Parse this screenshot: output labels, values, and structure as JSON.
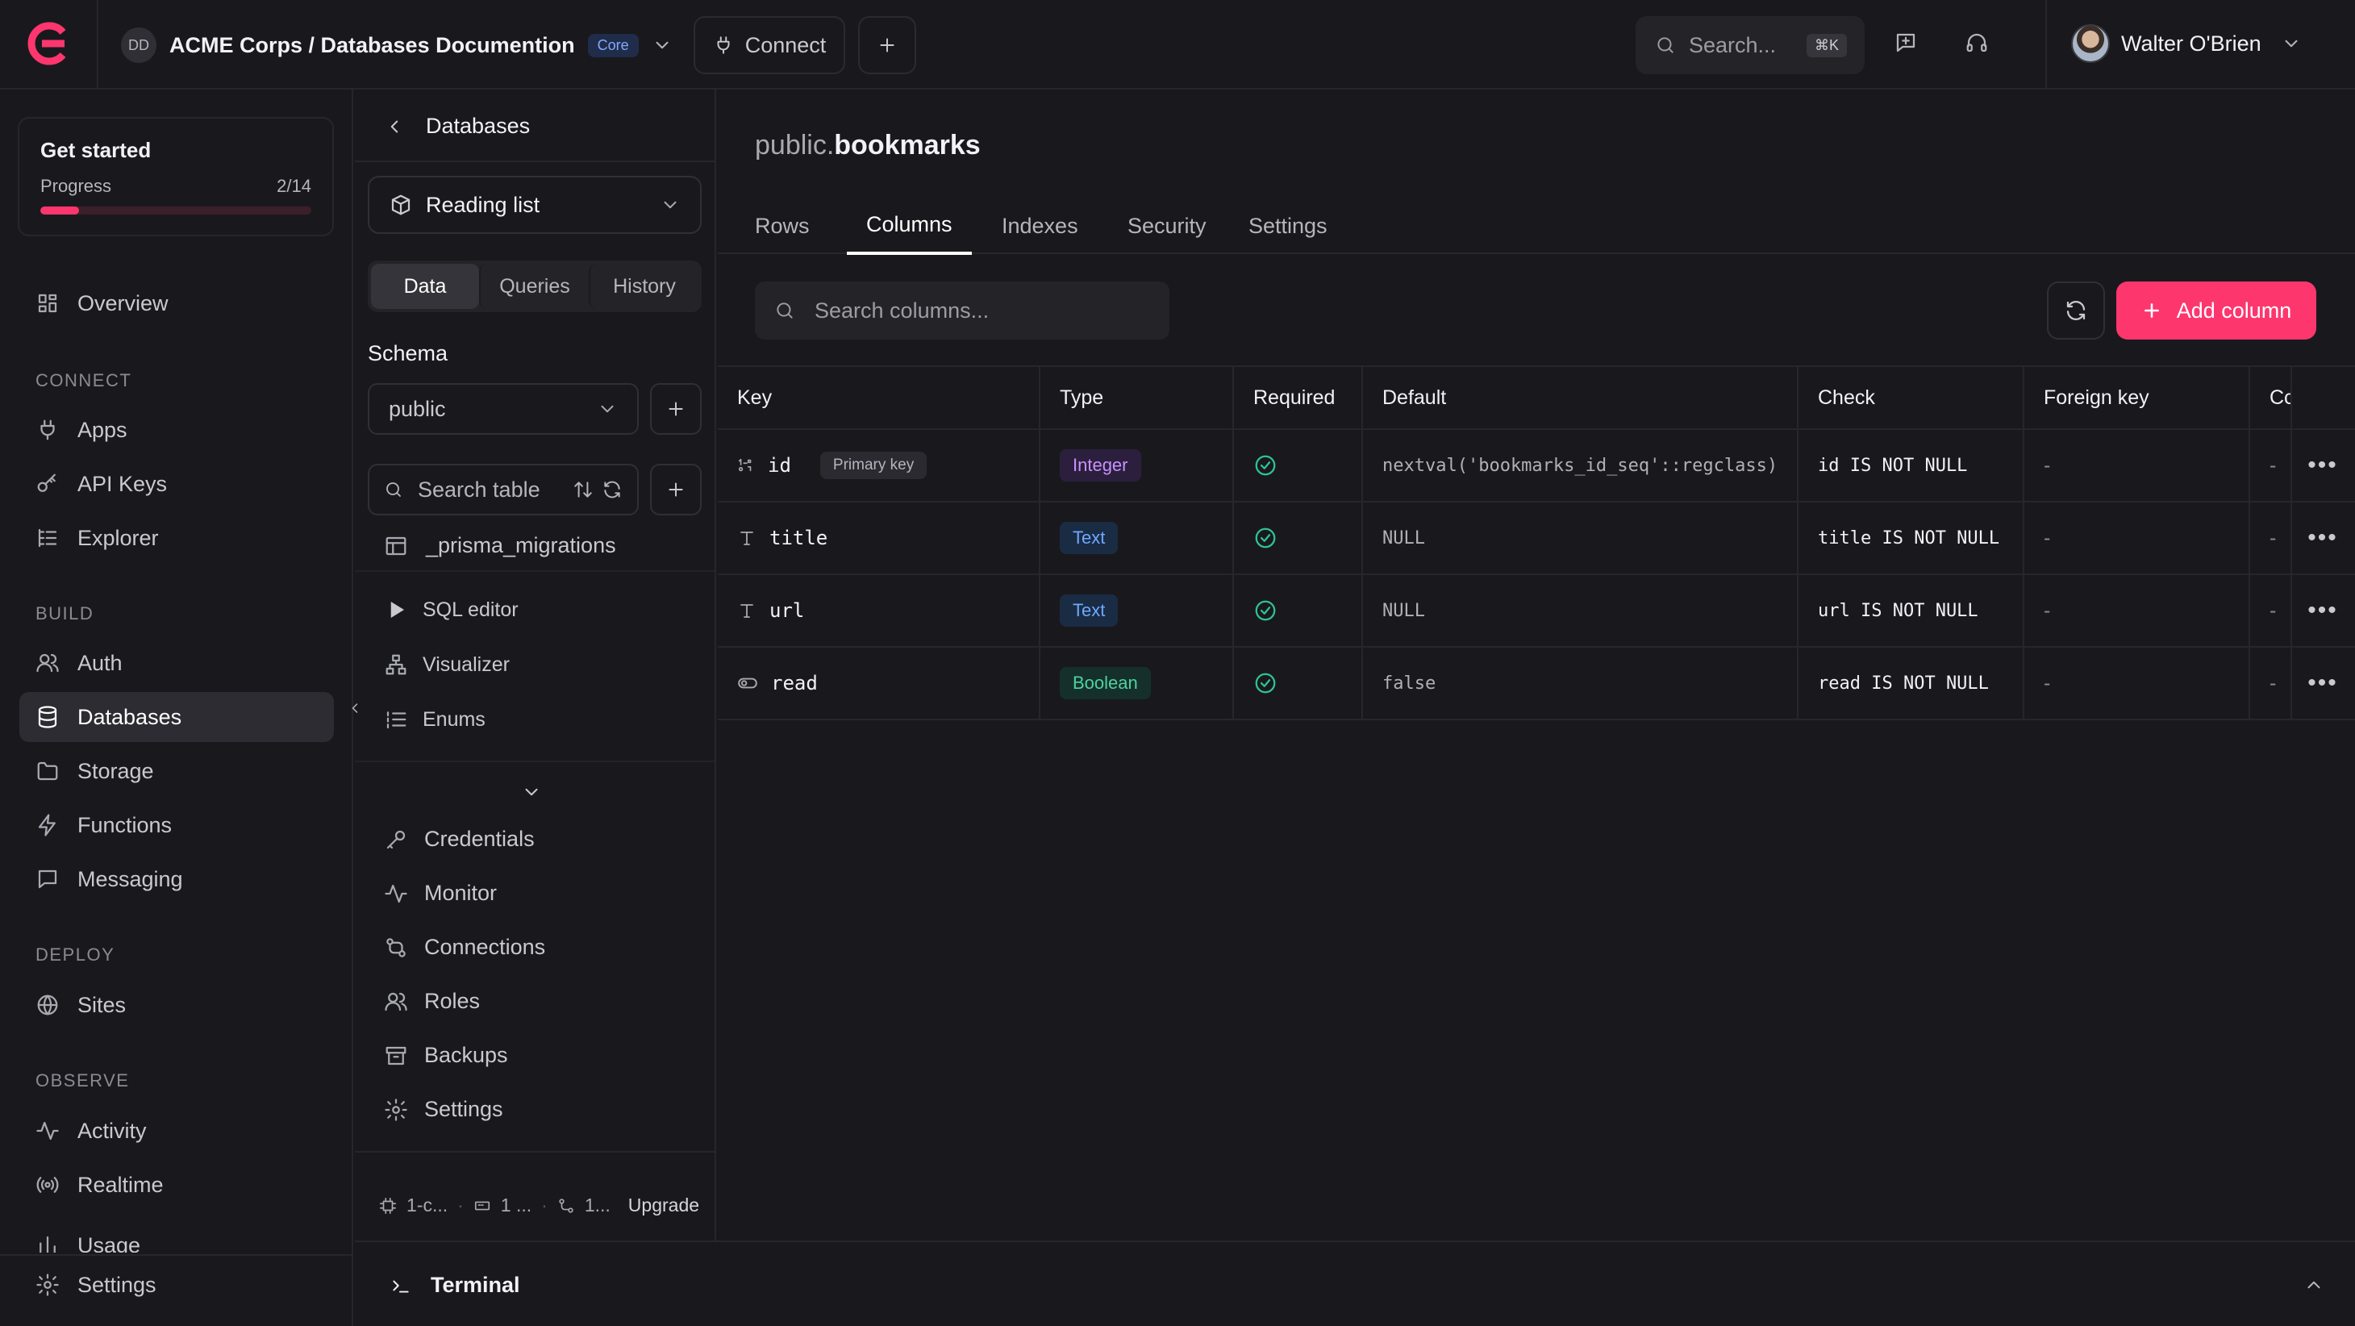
{
  "topbar": {
    "project_initials": "DD",
    "project_title": "ACME Corps / Databases Documention",
    "plan_badge": "Core",
    "connect_label": "Connect",
    "search_placeholder": "Search...",
    "search_shortcut": "⌘K",
    "user_name": "Walter O'Brien"
  },
  "getstarted": {
    "title": "Get started",
    "progress_label": "Progress",
    "progress_text": "2/14",
    "progress_value": 0.143
  },
  "nav": {
    "overview": "Overview",
    "connect_section": "CONNECT",
    "apps": "Apps",
    "api_keys": "API Keys",
    "explorer": "Explorer",
    "build_section": "BUILD",
    "auth": "Auth",
    "databases": "Databases",
    "storage": "Storage",
    "functions": "Functions",
    "messaging": "Messaging",
    "deploy_section": "DEPLOY",
    "sites": "Sites",
    "observe_section": "OBSERVE",
    "activity": "Activity",
    "realtime": "Realtime",
    "usage": "Usage",
    "settings": "Settings"
  },
  "midpanel": {
    "back_title": "Databases",
    "database_select": "Reading list",
    "tabs": [
      "Data",
      "Queries",
      "History"
    ],
    "schema_label": "Schema",
    "schema_value": "public",
    "table_search_placeholder": "Search table",
    "tables": [
      "_prisma_migrations"
    ],
    "tools": [
      "SQL editor",
      "Visualizer",
      "Enums"
    ],
    "bottom_items": [
      "Credentials",
      "Monitor",
      "Connections",
      "Roles",
      "Backups",
      "Settings"
    ],
    "footer": {
      "compute": "1-c...",
      "storage": "1 ...",
      "connections": "1...",
      "upgrade": "Upgrade"
    }
  },
  "main": {
    "schema_prefix": "public.",
    "table_name": "bookmarks",
    "tabs": [
      "Rows",
      "Columns",
      "Indexes",
      "Security",
      "Settings"
    ],
    "active_tab": "Columns",
    "search_placeholder": "Search columns...",
    "add_column_label": "Add column",
    "columns": {
      "headers": [
        "Key",
        "Type",
        "Required",
        "Default",
        "Check",
        "Foreign key",
        "Cc"
      ],
      "rows": [
        {
          "key": "id",
          "icon": "key-number-icon",
          "primary_key": "Primary key",
          "type": "Integer",
          "required": true,
          "default": "nextval('bookmarks_id_seq'::regclass)",
          "check": "id IS NOT NULL",
          "foreign_key": "-",
          "extra": "-"
        },
        {
          "key": "title",
          "icon": "text-type-icon",
          "type": "Text",
          "required": true,
          "default": "NULL",
          "check": "title IS NOT NULL",
          "foreign_key": "-",
          "extra": "-"
        },
        {
          "key": "url",
          "icon": "text-type-icon",
          "type": "Text",
          "required": true,
          "default": "NULL",
          "check": "url IS NOT NULL",
          "foreign_key": "-",
          "extra": "-"
        },
        {
          "key": "read",
          "icon": "toggle-icon",
          "type": "Boolean",
          "required": true,
          "default": "false",
          "check": "read IS NOT NULL",
          "foreign_key": "-",
          "extra": "-"
        }
      ]
    }
  },
  "terminal": {
    "label": "Terminal"
  },
  "colors": {
    "accent": "#fd366e",
    "background": "#19191d",
    "success": "#2fc48f"
  }
}
